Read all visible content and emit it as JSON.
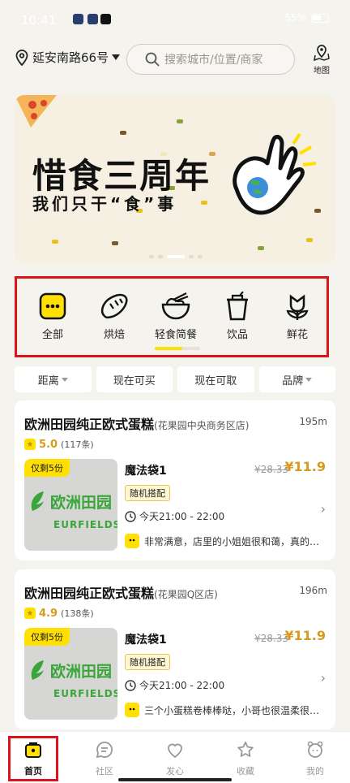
{
  "status_bar": {
    "time": "10:41",
    "battery": "55%"
  },
  "header": {
    "location": "延安南路66号",
    "search_placeholder": "搜索城市/位置/商家",
    "map_label": "地图"
  },
  "banner": {
    "title": "惜食三周年",
    "subtitle": "我们只干“食”事"
  },
  "categories": [
    {
      "label": "全部",
      "icon": "all-icon"
    },
    {
      "label": "烘焙",
      "icon": "bread-icon"
    },
    {
      "label": "轻食简餐",
      "icon": "bowl-icon"
    },
    {
      "label": "饮品",
      "icon": "drink-icon"
    },
    {
      "label": "鲜花",
      "icon": "flower-icon"
    }
  ],
  "filters": [
    "距离",
    "现在可买",
    "现在可取",
    "品牌"
  ],
  "stores": [
    {
      "name": "欧洲田园纯正欧式蛋糕",
      "branch": "(花果园中央商务区店)",
      "distance": "195m",
      "rating": "5.0",
      "reviews": "(117条)",
      "stock_tag": "仅剩5份",
      "logo_text": "欧洲田园",
      "logo_en": "EURFIELDS",
      "bag_name": "魔法袋1",
      "old_price": "¥28.33",
      "price": "¥11.9",
      "tag": "随机搭配",
      "pickup": "今天21:00 - 22:00",
      "comment": "非常满意，店里的小姐姐很和蔼，真的…"
    },
    {
      "name": "欧洲田园纯正欧式蛋糕",
      "branch": "(花果园Q区店)",
      "distance": "196m",
      "rating": "4.9",
      "reviews": "(138条)",
      "stock_tag": "仅剩5份",
      "logo_text": "欧洲田园",
      "logo_en": "EURFIELDS",
      "bag_name": "魔法袋1",
      "old_price": "¥28.33",
      "price": "¥11.9",
      "tag": "随机搭配",
      "pickup": "今天21:00 - 22:00",
      "comment": "三个小蛋糕卷棒棒哒，小哥也很温柔很…"
    }
  ],
  "nav": [
    {
      "label": "首页",
      "icon": "home-icon"
    },
    {
      "label": "社区",
      "icon": "chat-icon"
    },
    {
      "label": "发心",
      "icon": "heart-icon"
    },
    {
      "label": "收藏",
      "icon": "star-icon"
    },
    {
      "label": "我的",
      "icon": "profile-icon"
    }
  ],
  "colors": {
    "accent": "#ffe000",
    "price": "#d79a1a",
    "highlight_border": "#d9151b"
  }
}
